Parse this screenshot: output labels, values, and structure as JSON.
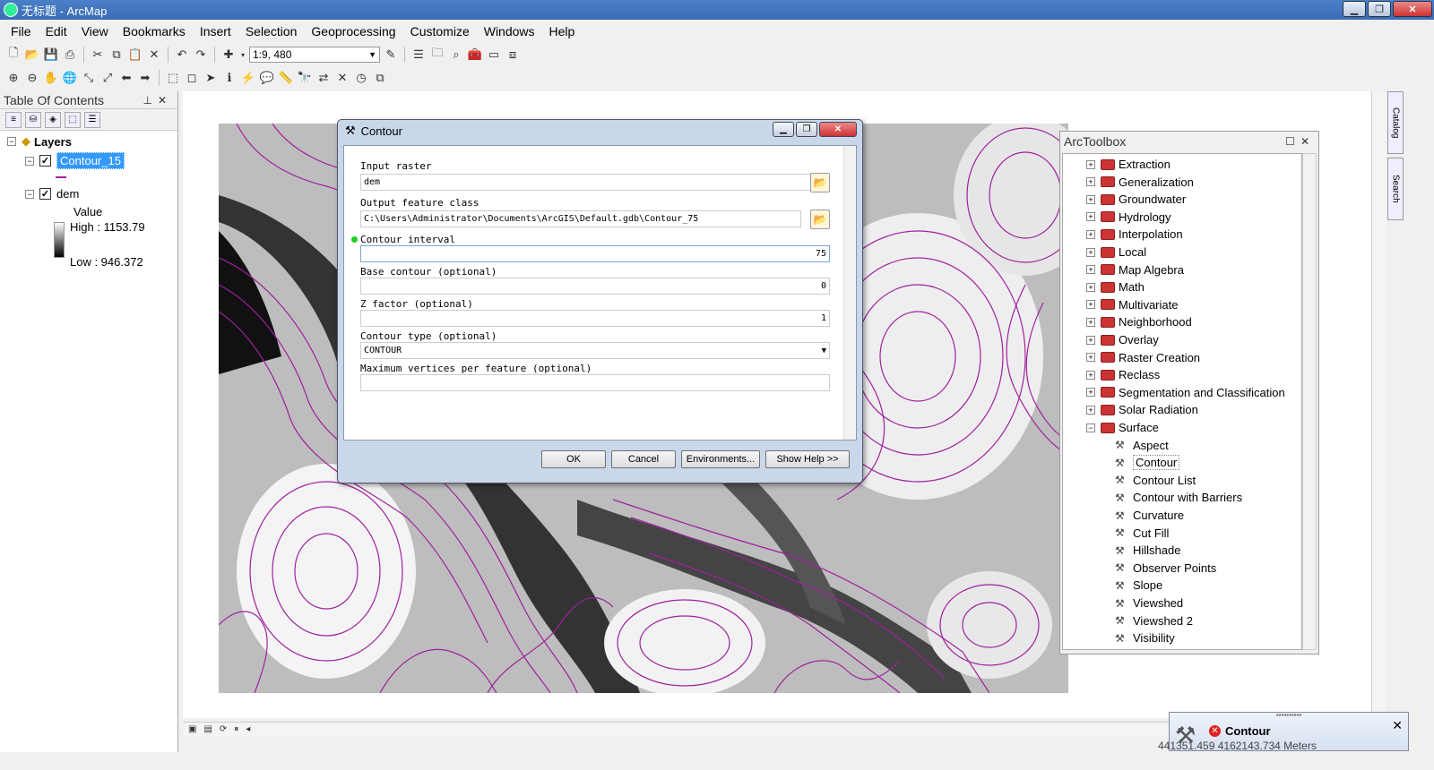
{
  "window": {
    "title": "无标题 - ArcMap"
  },
  "menu": [
    "File",
    "Edit",
    "View",
    "Bookmarks",
    "Insert",
    "Selection",
    "Geoprocessing",
    "Customize",
    "Windows",
    "Help"
  ],
  "toolbar": {
    "scale": "1:9, 480"
  },
  "toc": {
    "title": "Table Of Contents",
    "layers_label": "Layers",
    "contour_layer": "Contour_15",
    "dem_layer": "dem",
    "value_label": "Value",
    "high": "High : 1153.79",
    "low": "Low : 946.372"
  },
  "dialog": {
    "title": "Contour",
    "input_raster_label": "Input raster",
    "input_raster_value": "dem",
    "output_label": "Output feature class",
    "output_value": "C:\\Users\\Administrator\\Documents\\ArcGIS\\Default.gdb\\Contour_75",
    "interval_label": "Contour interval",
    "interval_value": "75",
    "base_label": "Base contour (optional)",
    "base_value": "0",
    "zfactor_label": "Z factor (optional)",
    "zfactor_value": "1",
    "type_label": "Contour type (optional)",
    "type_value": "CONTOUR",
    "maxvert_label": "Maximum vertices per feature (optional)",
    "maxvert_value": "",
    "ok": "OK",
    "cancel": "Cancel",
    "environments": "Environments...",
    "showhelp": "Show Help >>"
  },
  "toolbox": {
    "title": "ArcToolbox",
    "toolsets": [
      "Extraction",
      "Generalization",
      "Groundwater",
      "Hydrology",
      "Interpolation",
      "Local",
      "Map Algebra",
      "Math",
      "Multivariate",
      "Neighborhood",
      "Overlay",
      "Raster Creation",
      "Reclass",
      "Segmentation and Classification",
      "Solar Radiation",
      "Surface"
    ],
    "surface_tools": [
      "Aspect",
      "Contour",
      "Contour List",
      "Contour with Barriers",
      "Curvature",
      "Cut Fill",
      "Hillshade",
      "Observer Points",
      "Slope",
      "Viewshed",
      "Viewshed 2",
      "Visibility"
    ]
  },
  "side_tabs": [
    "Catalog",
    "Search"
  ],
  "notification": {
    "title": "Contour"
  },
  "status": {
    "coords": "441351.459  4162143.734 Meters"
  },
  "colors": {
    "contour_line": "#a020a0",
    "selection": "#3399ff",
    "titlebar": "#3a6cb6"
  }
}
